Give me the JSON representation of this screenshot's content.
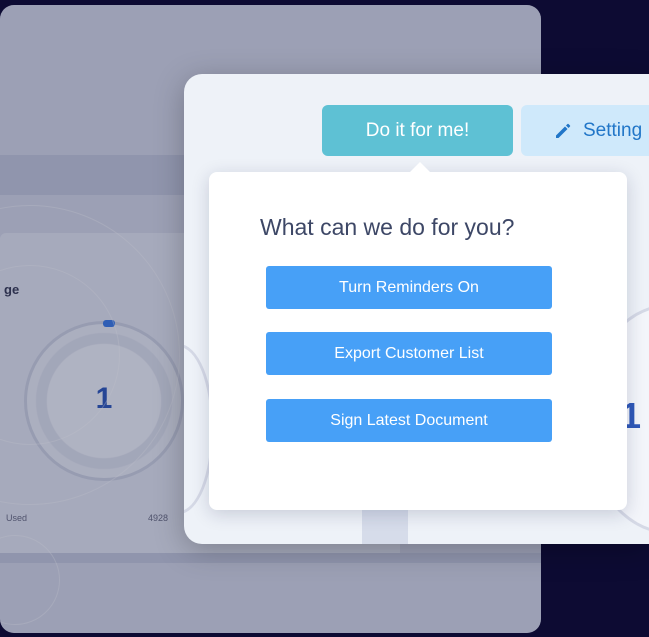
{
  "background": {
    "panel_title": "ge",
    "gauge_value": "1",
    "footer_left": "Used",
    "footer_right": "4928"
  },
  "foreground": {
    "gauge_value": "1"
  },
  "toolbar": {
    "do_it_label": "Do it for me!",
    "settings_label": "Setting"
  },
  "popover": {
    "title": "What can we do for you?",
    "actions": [
      {
        "label": "Turn Reminders On"
      },
      {
        "label": "Export Customer List"
      },
      {
        "label": "Sign Latest Document"
      }
    ]
  },
  "colors": {
    "page_background": "#0d0b33",
    "do_it_button": "#5ec1d4",
    "settings_button": "#cfe9fb",
    "action_button": "#47a0f7",
    "gauge_text": "#2f58b8"
  },
  "icons": {
    "settings": "pencil-icon"
  }
}
